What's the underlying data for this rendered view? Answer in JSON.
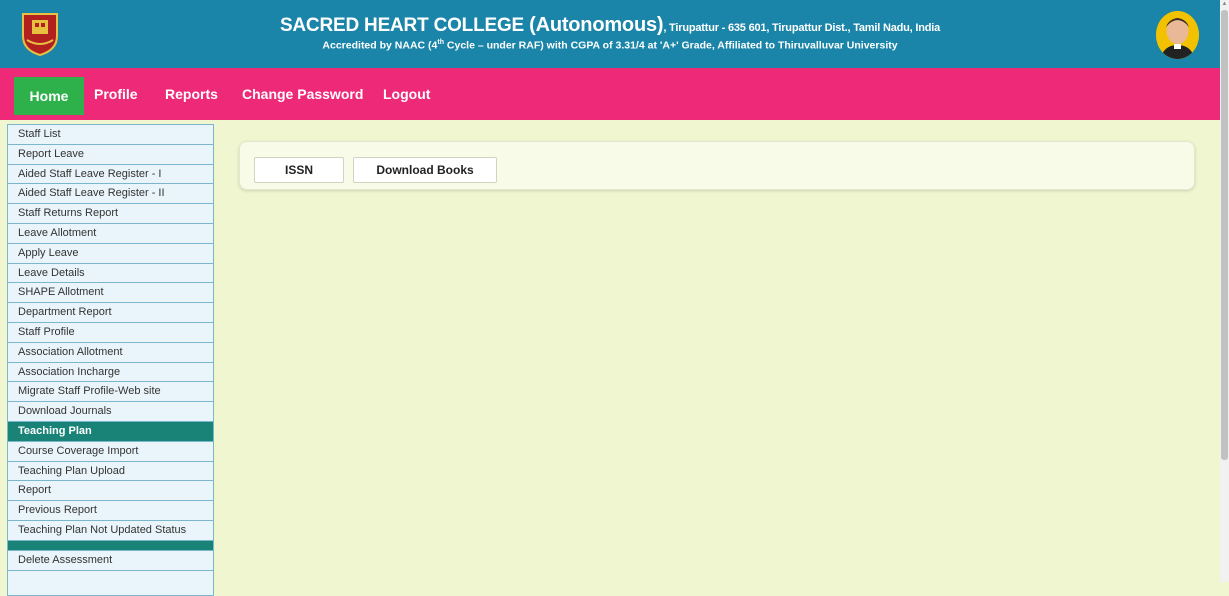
{
  "header": {
    "title_main": "SACRED HEART COLLEGE",
    "title_auto": "(Autonomous)",
    "title_address": ", Tirupattur - 635 601, Tirupattur Dist., Tamil Nadu, India",
    "sub_a": "Accredited by NAAC (4",
    "sub_sup": "th",
    "sub_b": " Cycle – under RAF) with CGPA of 3.31/4 at 'A+' Grade, Affiliated to Thiruvalluvar University"
  },
  "nav": {
    "home": "Home",
    "profile": "Profile",
    "reports": "Reports",
    "change_password": "Change Password",
    "logout": "Logout"
  },
  "sidebar": {
    "items": [
      "Staff List",
      "Report Leave",
      "Aided Staff Leave Register - I",
      "Aided Staff Leave Register - II",
      "Staff Returns Report",
      "Leave Allotment",
      "Apply Leave",
      "Leave Details",
      "SHAPE Allotment",
      "Department Report",
      "Staff Profile",
      "Association Allotment",
      "Association Incharge",
      "Migrate Staff Profile-Web site",
      "Download Journals"
    ],
    "section_teaching": "Teaching Plan",
    "teaching_items": [
      "Course Coverage Import",
      "Teaching Plan Upload",
      "Report",
      "Previous Report",
      "Teaching Plan Not Updated Status"
    ],
    "after_items": [
      "Delete Assessment"
    ]
  },
  "content": {
    "tab_issn": "ISSN",
    "tab_download_books": "Download Books"
  },
  "colors": {
    "header_bg": "#1a85a8",
    "nav_bg": "#ee2a78",
    "home_active": "#2eb14a",
    "section_bg": "#1a8378",
    "page_bg": "#f0f6cf"
  }
}
